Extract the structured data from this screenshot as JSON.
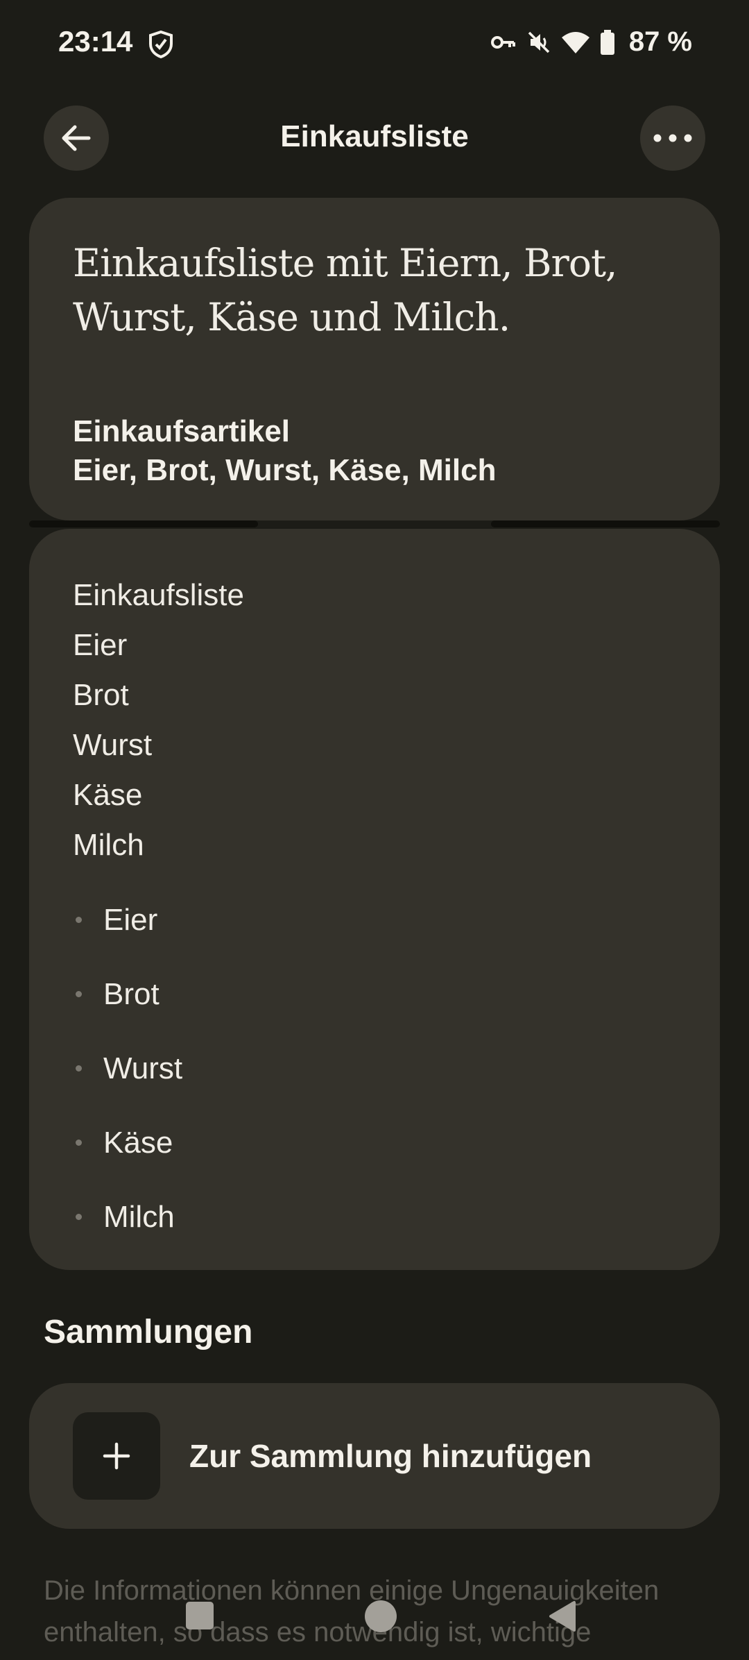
{
  "status_bar": {
    "time": "23:14",
    "battery": "87 %",
    "icons": [
      "shield-icon",
      "key-icon",
      "mute-icon",
      "wifi-icon",
      "battery-icon"
    ]
  },
  "app_bar": {
    "title": "Einkaufsliste",
    "back_icon": "arrow-back-icon",
    "more_icon": "more-horizontal-icon"
  },
  "summary": {
    "line1": "Einkaufsliste mit Eiern, Brot,",
    "line2": "Wurst, Käse und Milch.",
    "articles_label": "Einkaufsartikel",
    "articles_value": "Eier, Brot, Wurst, Käse, Milch"
  },
  "list": {
    "lines": [
      "Einkaufsliste",
      "Eier",
      "Brot",
      "Wurst",
      "Käse",
      "Milch"
    ],
    "bullets": [
      "Eier",
      "Brot",
      "Wurst",
      "Käse",
      "Milch"
    ]
  },
  "collections": {
    "title": "Sammlungen",
    "add_label": "Zur Sammlung hinzufügen",
    "add_icon": "plus-icon"
  },
  "disclaimer": "Die Informationen können einige Ungenauigkeiten enthalten, so dass es notwendig ist, wichtige",
  "colors": {
    "background": "#1c1c17",
    "card": "#34322b",
    "text": "#f0ede6",
    "muted": "#5e5c55"
  }
}
